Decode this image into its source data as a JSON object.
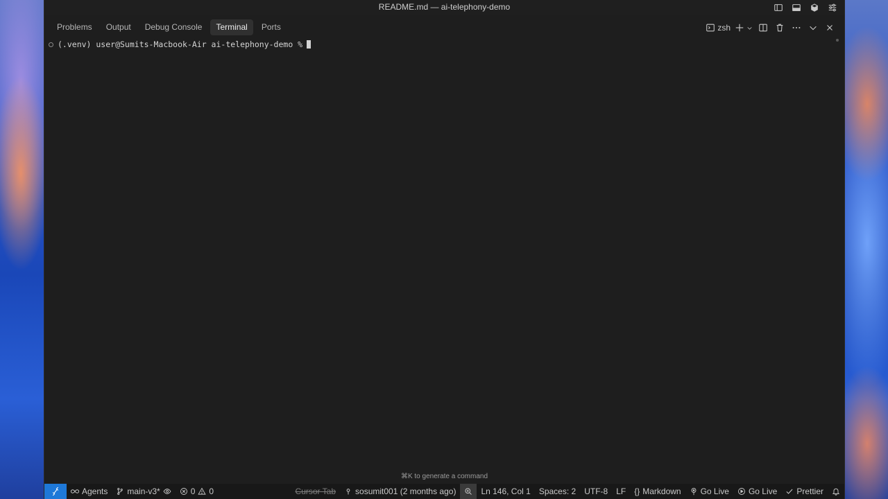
{
  "window": {
    "title": "README.md — ai-telephony-demo"
  },
  "panel": {
    "tabs": [
      {
        "label": "Problems",
        "active": false
      },
      {
        "label": "Output",
        "active": false
      },
      {
        "label": "Debug Console",
        "active": false
      },
      {
        "label": "Terminal",
        "active": true
      },
      {
        "label": "Ports",
        "active": false
      }
    ],
    "shell_label": "zsh"
  },
  "terminal": {
    "prompt": "(.venv) user@Sumits-Macbook-Air ai-telephony-demo %",
    "hint": "⌘K to generate a command"
  },
  "statusbar": {
    "agents": "Agents",
    "branch": "main-v3*",
    "errors": "0",
    "warnings": "0",
    "cursor_tab": "Cursor Tab",
    "blame": "sosumit001 (2 months ago)",
    "position": "Ln 146, Col 1",
    "spaces": "Spaces: 2",
    "encoding": "UTF-8",
    "eol": "LF",
    "language": "Markdown",
    "go_live_1": "Go Live",
    "go_live_2": "Go Live",
    "prettier": "Prettier"
  },
  "colors": {
    "accent": "#1e78d8",
    "background": "#1e1e1e",
    "statusbar": "#181818"
  }
}
